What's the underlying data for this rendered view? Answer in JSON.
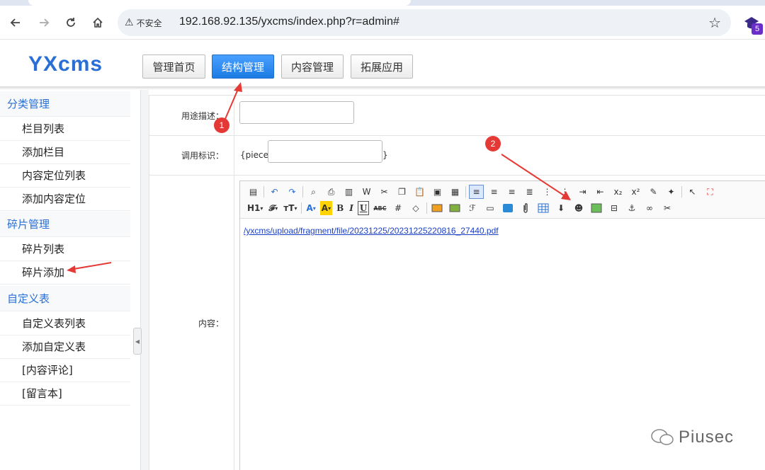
{
  "browser": {
    "back_icon": "arrow-left-icon",
    "forward_icon": "arrow-right-icon",
    "reload_icon": "reload-icon",
    "home_icon": "home-icon",
    "security_label": "不安全",
    "url": "192.168.92.135/yxcms/index.php?r=admin#",
    "star_icon": "star-icon",
    "extension_badge": "5"
  },
  "header": {
    "logo": "YXcms",
    "nav": [
      {
        "label": "管理首页"
      },
      {
        "label": "结构管理"
      },
      {
        "label": "内容管理"
      },
      {
        "label": "拓展应用"
      }
    ],
    "active_index": 1
  },
  "sidebar": {
    "groups": [
      {
        "title": "分类管理",
        "items": [
          "栏目列表",
          "添加栏目",
          "内容定位列表",
          "添加内容定位"
        ]
      },
      {
        "title": "碎片管理",
        "items": [
          "碎片列表",
          "碎片添加"
        ]
      },
      {
        "title": "自定义表",
        "items": [
          "自定义表列表",
          "添加自定义表",
          "[内容评论]",
          "[留言本]"
        ]
      }
    ]
  },
  "form": {
    "desc_label": "用途描述：",
    "desc_value": "",
    "tag_label": "调用标识：",
    "tag_prefix": "{piece:",
    "tag_value": "",
    "tag_suffix": "}",
    "content_label": "内容："
  },
  "editor": {
    "toolbar_row1": [
      "source",
      "sep",
      "undo",
      "redo",
      "sep",
      "preview",
      "print",
      "template",
      "paste-word",
      "cut",
      "copy",
      "paste",
      "paste-plain",
      "paste-word2",
      "sep",
      "align-left",
      "align-center",
      "align-right",
      "align-justify",
      "ordered-list",
      "unordered-list",
      "indent",
      "outdent",
      "subscript",
      "superscript",
      "clear-format",
      "select-all",
      "sep",
      "pointer",
      "fullscreen"
    ],
    "toolbar_row2_text": [
      "H1",
      "𝓕",
      "тT",
      "A",
      "A",
      "B",
      "I",
      "U",
      "ABC"
    ],
    "content_link": "/yxcms/upload/fragment/file/20231225/20231225220816_27440.pdf"
  },
  "annotations": {
    "badge1": "1",
    "badge2": "2",
    "color": "#e53935"
  },
  "watermark": "Piusec"
}
